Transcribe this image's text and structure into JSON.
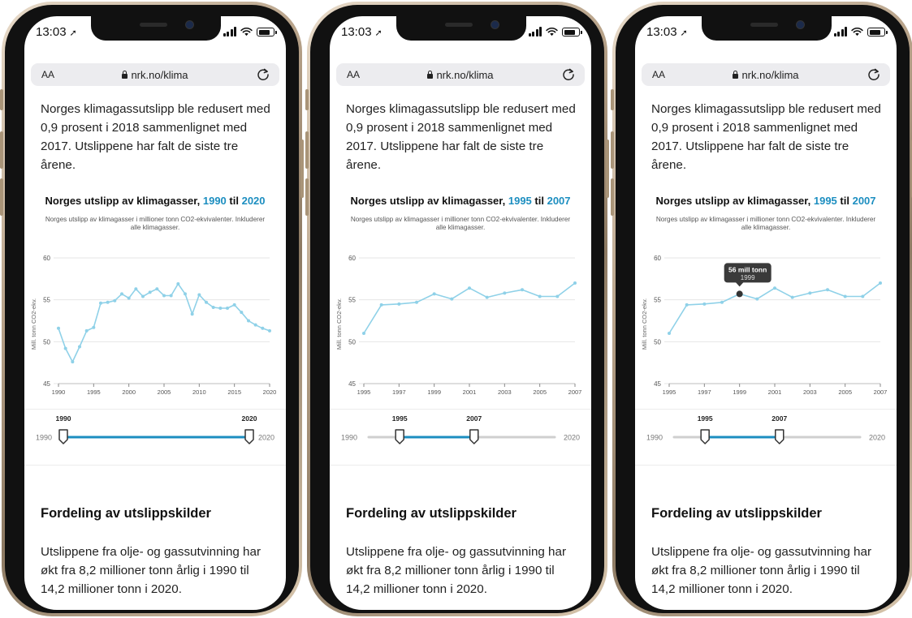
{
  "status": {
    "time": "13:03"
  },
  "browser": {
    "aa_label": "AA",
    "url": "nrk.no/klima"
  },
  "article": {
    "intro": "Norges klimagassutslipp ble redusert med 0,9 prosent i 2018 sammenlignet med 2017. Utslippene har falt de siste tre årene.",
    "section_title": "Fordeling av utslippskilder",
    "section_body": "Utslippene fra olje- og gassutvinning har økt fra 8,2 millioner tonn årlig i 1990 til 14,2 millioner tonn i 2020."
  },
  "colors": {
    "line": "#8fd1e8",
    "accent": "#1c8ec0",
    "slider_fill": "#1c8ec0",
    "slider_track": "#cfcfcf",
    "tooltip_bg": "#3a3a3a"
  },
  "range_limits": {
    "min_label": "1990",
    "max_label": "2020"
  },
  "phones": [
    {
      "title_prefix": "Norges utslipp av klimagasser,",
      "title_from": "1990",
      "title_to_word": "til",
      "title_to": "2020",
      "subtitle": "Norges utslipp av klimagasser i millioner tonn CO2-ekvivalenter. Inkluderer alle klimagasser.",
      "slider": {
        "from_label": "1990",
        "to_label": "2020"
      },
      "chart_data": {
        "type": "line",
        "ylabel": "Mill. tonn CO2-ekv.",
        "ylim": [
          45,
          60
        ],
        "yticks": [
          "45",
          "50",
          "55",
          "60"
        ],
        "xlim": [
          1990,
          2020
        ],
        "xticks": [
          "1990",
          "1995",
          "2000",
          "2005",
          "2010",
          "2015",
          "2020"
        ],
        "x": [
          1990,
          1991,
          1992,
          1993,
          1994,
          1995,
          1996,
          1997,
          1998,
          1999,
          2000,
          2001,
          2002,
          2003,
          2004,
          2005,
          2006,
          2007,
          2008,
          2009,
          2010,
          2011,
          2012,
          2013,
          2014,
          2015,
          2016,
          2017,
          2018,
          2019,
          2020
        ],
        "values": [
          51.6,
          49.2,
          47.6,
          49.4,
          51.3,
          51.7,
          54.6,
          54.7,
          54.9,
          55.7,
          55.2,
          56.3,
          55.4,
          55.9,
          56.3,
          55.5,
          55.5,
          56.9,
          55.7,
          53.3,
          55.6,
          54.7,
          54.1,
          54.0,
          54.0,
          54.4,
          53.5,
          52.5,
          52.0,
          51.6,
          51.3
        ],
        "tooltip": null
      }
    },
    {
      "title_prefix": "Norges utslipp av klimagasser,",
      "title_from": "1995",
      "title_to_word": "til",
      "title_to": "2007",
      "subtitle": "Norges utslipp av klimagasser i millioner tonn CO2-ekvivalenter. Inkluderer alle klimagasser.",
      "slider": {
        "from_label": "1995",
        "to_label": "2007"
      },
      "chart_data": {
        "type": "line",
        "ylabel": "Mill. tonn CO2-ekv.",
        "ylim": [
          45,
          60
        ],
        "yticks": [
          "45",
          "50",
          "55",
          "60"
        ],
        "xlim": [
          1995,
          2007
        ],
        "xticks": [
          "1995",
          "1997",
          "1999",
          "2001",
          "2003",
          "2005",
          "2007"
        ],
        "x": [
          1995,
          1996,
          1997,
          1998,
          1999,
          2000,
          2001,
          2002,
          2003,
          2004,
          2005,
          2006,
          2007
        ],
        "values": [
          51.0,
          54.4,
          54.5,
          54.7,
          55.7,
          55.1,
          56.4,
          55.3,
          55.8,
          56.2,
          55.4,
          55.4,
          57.0
        ],
        "tooltip": null
      }
    },
    {
      "title_prefix": "Norges utslipp av klimagasser,",
      "title_from": "1995",
      "title_to_word": "til",
      "title_to": "2007",
      "subtitle": "Norges utslipp av klimagasser i millioner tonn CO2-ekvivalenter. Inkluderer alle klimagasser.",
      "slider": {
        "from_label": "1995",
        "to_label": "2007"
      },
      "chart_data": {
        "type": "line",
        "ylabel": "Mill. tonn CO2-ekv.",
        "ylim": [
          45,
          60
        ],
        "yticks": [
          "45",
          "50",
          "55",
          "60"
        ],
        "xlim": [
          1995,
          2007
        ],
        "xticks": [
          "1995",
          "1997",
          "1999",
          "2001",
          "2003",
          "2005",
          "2007"
        ],
        "x": [
          1995,
          1996,
          1997,
          1998,
          1999,
          2000,
          2001,
          2002,
          2003,
          2004,
          2005,
          2006,
          2007
        ],
        "values": [
          51.0,
          54.4,
          54.5,
          54.7,
          55.7,
          55.1,
          56.4,
          55.3,
          55.8,
          56.2,
          55.4,
          55.4,
          57.0
        ],
        "tooltip": {
          "index": 4,
          "value_label": "56 mill tonn",
          "year_label": "1999"
        }
      }
    }
  ]
}
